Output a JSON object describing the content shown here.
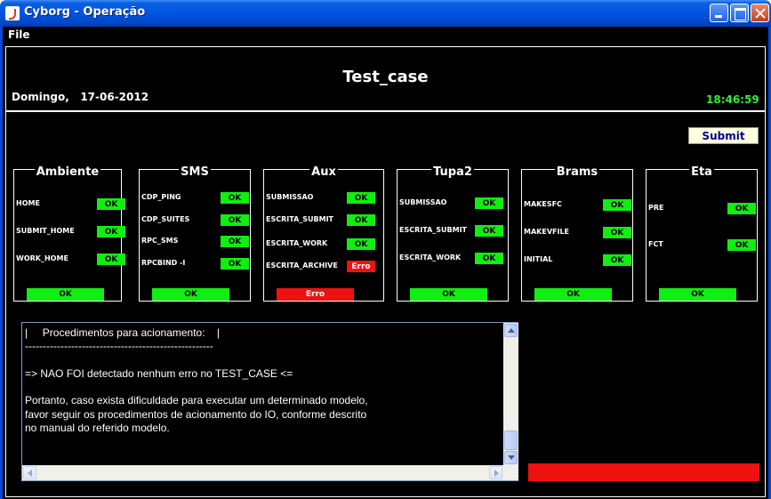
{
  "window": {
    "title": "Cyborg - Operação"
  },
  "menu": {
    "file": "File"
  },
  "header": {
    "title": "Test_case",
    "day": "Domingo,",
    "date": "17-06-2012",
    "time": "18:46:59"
  },
  "submit_label": "Submit",
  "panels": [
    {
      "title": "Ambiente",
      "rows": [
        {
          "label": "HOME",
          "status": "OK"
        },
        {
          "label": "SUBMIT_HOME",
          "status": "OK"
        },
        {
          "label": "WORK_HOME",
          "status": "OK"
        }
      ],
      "overall": "OK"
    },
    {
      "title": "SMS",
      "rows": [
        {
          "label": "CDP_PING",
          "status": "OK"
        },
        {
          "label": "CDP_SUITES",
          "status": "OK"
        },
        {
          "label": "RPC_SMS",
          "status": "OK"
        },
        {
          "label": "RPCBIND -I",
          "status": "OK"
        }
      ],
      "overall": "OK"
    },
    {
      "title": "Aux",
      "rows": [
        {
          "label": "SUBMISSAO",
          "status": "OK"
        },
        {
          "label": "ESCRITA_SUBMIT",
          "status": "OK"
        },
        {
          "label": "ESCRITA_WORK",
          "status": "OK"
        },
        {
          "label": "ESCRITA_ARCHIVE",
          "status": "Erro"
        }
      ],
      "overall": "Erro"
    },
    {
      "title": "Tupa2",
      "rows": [
        {
          "label": "SUBMISSAO",
          "status": "OK"
        },
        {
          "label": "ESCRITA_SUBMIT",
          "status": "OK"
        },
        {
          "label": "ESCRITA_WORK",
          "status": "OK"
        }
      ],
      "overall": "OK"
    },
    {
      "title": "Brams",
      "rows": [
        {
          "label": "MAKESFC",
          "status": "OK"
        },
        {
          "label": "MAKEVFILE",
          "status": "OK"
        },
        {
          "label": "INITIAL",
          "status": "OK"
        }
      ],
      "overall": "OK"
    },
    {
      "title": "Eta",
      "rows": [
        {
          "label": "PRE",
          "status": "OK"
        },
        {
          "label": "FCT",
          "status": "OK"
        }
      ],
      "overall": "OK"
    }
  ],
  "log": {
    "lines": [
      "|     Procedimentos para acionamento:    |",
      "-----------------------------------------------------",
      "",
      "=> NAO FOI detectado nenhum erro no TEST_CASE <=",
      "",
      "Portanto, caso exista dificuldade para executar um determinado modelo,",
      "favor seguir os procedimentos de acionamento do IO, conforme descrito",
      "no manual do referido modelo."
    ]
  },
  "colors": {
    "ok": "#11ee11",
    "error": "#ee1111",
    "time": "#33ee33",
    "background": "#000000"
  }
}
